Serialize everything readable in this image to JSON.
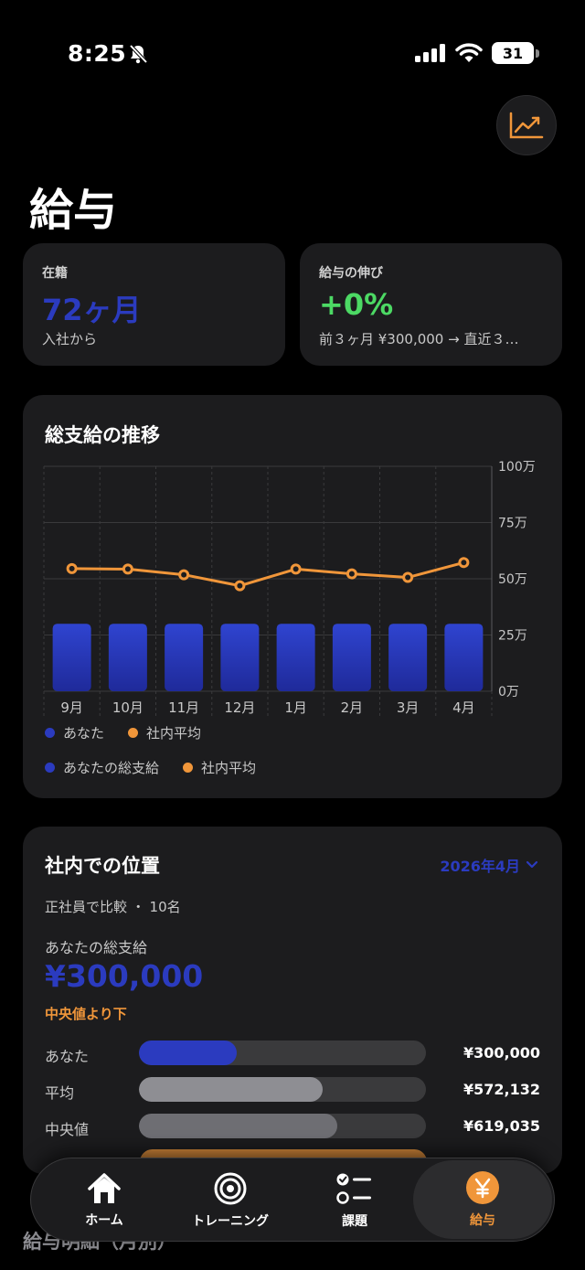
{
  "status_bar": {
    "time": "8:25",
    "battery": "31"
  },
  "page": {
    "title": "給与"
  },
  "stats": {
    "tenure": {
      "label": "在籍",
      "value": "72ヶ月",
      "sub": "入社から"
    },
    "growth": {
      "label": "給与の伸び",
      "value": "+0%",
      "sub": "前３ヶ月 ¥300,000 → 直近３…"
    }
  },
  "trend": {
    "title": "総支給の推移",
    "legend_inline": [
      "あなた",
      "社内平均"
    ],
    "legend_bottom": [
      "あなたの総支給",
      "社内平均"
    ],
    "y_tick_labels": [
      "100万",
      "75万",
      "50万",
      "25万",
      "0万"
    ]
  },
  "chart_data": {
    "type": "bar",
    "categories": [
      "9月",
      "10月",
      "11月",
      "12月",
      "1月",
      "2月",
      "3月",
      "4月"
    ],
    "ylim": [
      0,
      100
    ],
    "y_ticks": [
      0,
      25,
      50,
      75,
      100
    ],
    "series": [
      {
        "name": "あなた",
        "type": "bar",
        "color": "#2b3bbf",
        "values": [
          30,
          30,
          30,
          30,
          30,
          30,
          30,
          30
        ]
      },
      {
        "name": "社内平均",
        "type": "line",
        "color": "#f0963a",
        "values": [
          54.5,
          54.3,
          51.8,
          46.9,
          54.3,
          52.2,
          50.6,
          57.2
        ]
      }
    ],
    "legend": "bottom-left",
    "grid": true
  },
  "position": {
    "title": "社内での位置",
    "period": "2026年4月",
    "compare": "正社員で比較 ・ 10名",
    "gross_label": "あなたの総支給",
    "gross_value": "¥300,000",
    "status": "中央値より下",
    "rows": [
      {
        "label": "あなた",
        "value": "¥300,000",
        "fraction": 0.34,
        "color": "#2b3bbf"
      },
      {
        "label": "平均",
        "value": "¥572,132",
        "fraction": 0.64,
        "color": "#8e8e93"
      },
      {
        "label": "中央値",
        "value": "¥619,035",
        "fraction": 0.69,
        "color": "#6e6e73"
      }
    ]
  },
  "next_section": {
    "title": "給与明細（月別）"
  },
  "tabs": [
    {
      "label": "ホーム",
      "icon": "house-icon"
    },
    {
      "label": "トレーニング",
      "icon": "target-icon"
    },
    {
      "label": "課題",
      "icon": "checklist-icon"
    },
    {
      "label": "給与",
      "icon": "yen-icon"
    }
  ],
  "colors": {
    "accent": "#2b3bbf",
    "positive": "#4cd964",
    "orange": "#f0963a",
    "card": "#1c1c1e"
  }
}
